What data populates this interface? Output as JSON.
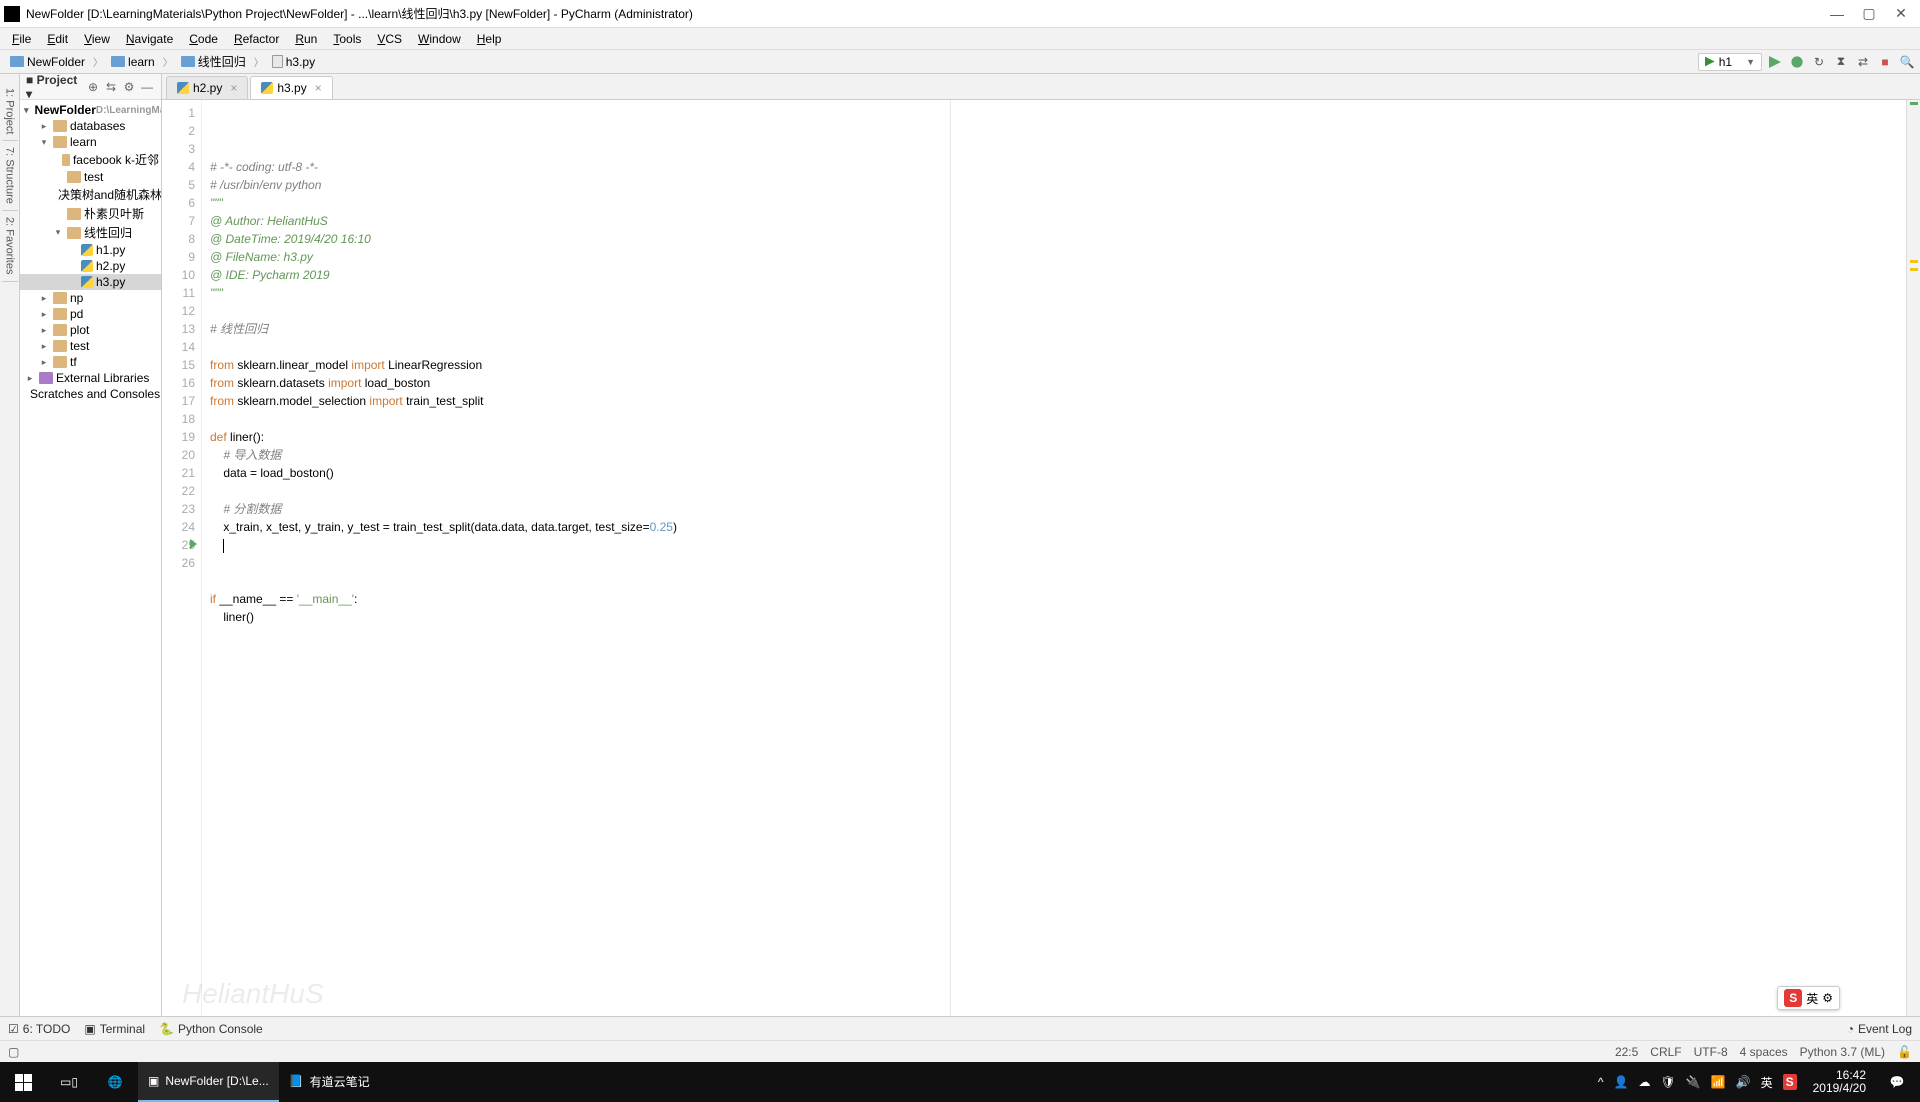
{
  "window": {
    "title": "NewFolder [D:\\LearningMaterials\\Python Project\\NewFolder] - ...\\learn\\线性回归\\h3.py [NewFolder] - PyCharm (Administrator)"
  },
  "menu": [
    "File",
    "Edit",
    "View",
    "Navigate",
    "Code",
    "Refactor",
    "Run",
    "Tools",
    "VCS",
    "Window",
    "Help"
  ],
  "breadcrumb": [
    {
      "type": "folder",
      "label": "NewFolder"
    },
    {
      "type": "folder",
      "label": "learn"
    },
    {
      "type": "folder",
      "label": "线性回归"
    },
    {
      "type": "file",
      "label": "h3.py"
    }
  ],
  "run_config": {
    "label": "h1"
  },
  "project_panel": {
    "title": "Project",
    "tree": {
      "root_label": "NewFolder",
      "root_hint": "D:\\LearningMa",
      "nodes": [
        {
          "label": "databases",
          "depth": 1,
          "toggle": "▸",
          "icon": "folder"
        },
        {
          "label": "learn",
          "depth": 1,
          "toggle": "▾",
          "icon": "folder"
        },
        {
          "label": "facebook k-近邻",
          "depth": 2,
          "toggle": "",
          "icon": "folder"
        },
        {
          "label": "test",
          "depth": 2,
          "toggle": "",
          "icon": "folder"
        },
        {
          "label": "决策树and随机森林",
          "depth": 2,
          "toggle": "",
          "icon": "folder"
        },
        {
          "label": "朴素贝叶斯",
          "depth": 2,
          "toggle": "",
          "icon": "folder"
        },
        {
          "label": "线性回归",
          "depth": 2,
          "toggle": "▾",
          "icon": "folder"
        },
        {
          "label": "h1.py",
          "depth": 3,
          "toggle": "",
          "icon": "pyfile"
        },
        {
          "label": "h2.py",
          "depth": 3,
          "toggle": "",
          "icon": "pyfile"
        },
        {
          "label": "h3.py",
          "depth": 3,
          "toggle": "",
          "icon": "pyfile",
          "selected": true
        },
        {
          "label": "np",
          "depth": 1,
          "toggle": "▸",
          "icon": "folder"
        },
        {
          "label": "pd",
          "depth": 1,
          "toggle": "▸",
          "icon": "folder"
        },
        {
          "label": "plot",
          "depth": 1,
          "toggle": "▸",
          "icon": "folder"
        },
        {
          "label": "test",
          "depth": 1,
          "toggle": "▸",
          "icon": "folder"
        },
        {
          "label": "tf",
          "depth": 1,
          "toggle": "▸",
          "icon": "folder"
        }
      ],
      "ext_lib": "External Libraries",
      "scratches": "Scratches and Consoles"
    }
  },
  "tabs": [
    {
      "label": "h2.py",
      "active": false
    },
    {
      "label": "h3.py",
      "active": true
    }
  ],
  "code_lines": [
    {
      "n": 1,
      "html": "<span class='c-comment'># -*- coding: utf-8 -*-</span>"
    },
    {
      "n": 2,
      "html": "<span class='c-comment'># /usr/bin/env python</span>"
    },
    {
      "n": 3,
      "html": "<span class='c-docstr'>\"\"\"</span>"
    },
    {
      "n": 4,
      "html": "<span class='c-docstr'>@ Author: HeliantHuS</span>"
    },
    {
      "n": 5,
      "html": "<span class='c-docstr'>@ DateTime: 2019/4/20 16:10</span>"
    },
    {
      "n": 6,
      "html": "<span class='c-docstr'>@ FileName: h3.py</span>"
    },
    {
      "n": 7,
      "html": "<span class='c-docstr'>@ IDE: Pycharm 2019</span>"
    },
    {
      "n": 8,
      "html": "<span class='c-docstr'>\"\"\"</span>"
    },
    {
      "n": 9,
      "html": ""
    },
    {
      "n": 10,
      "html": "<span class='c-comment'># 线性回归</span>"
    },
    {
      "n": 11,
      "html": ""
    },
    {
      "n": 12,
      "html": "<span class='c-kw'>from</span> sklearn.linear_model <span class='c-kw'>import</span> LinearRegression"
    },
    {
      "n": 13,
      "html": "<span class='c-kw'>from</span> sklearn.datasets <span class='c-kw'>import</span> load_boston"
    },
    {
      "n": 14,
      "html": "<span class='c-kw'>from</span> sklearn.model_selection <span class='c-kw'>import</span> train_test_split"
    },
    {
      "n": 15,
      "html": ""
    },
    {
      "n": 16,
      "html": "<span class='c-kw'>def</span> <span class='c-fn2'>liner</span>():"
    },
    {
      "n": 17,
      "html": "    <span class='c-comment'># 导入数据</span>"
    },
    {
      "n": 18,
      "html": "    data = load_boston()"
    },
    {
      "n": 19,
      "html": ""
    },
    {
      "n": 20,
      "html": "    <span class='c-comment'># 分割数据</span>"
    },
    {
      "n": 21,
      "html": "    x_train, x_test, y_train, y_test = train_test_split(data.data, data.target, <span>test_size=</span><span class='c-num'>0.25</span>)"
    },
    {
      "n": 22,
      "html": "    <span class='caret'></span>"
    },
    {
      "n": 23,
      "html": ""
    },
    {
      "n": 24,
      "html": ""
    },
    {
      "n": 25,
      "html": "<span class='c-kw'>if</span> __name__ == <span class='c-str'>'__main__'</span>:",
      "run": true
    },
    {
      "n": 26,
      "html": "    liner()"
    }
  ],
  "bottom_tools": {
    "todo": "6: TODO",
    "terminal": "Terminal",
    "python_console": "Python Console",
    "event_log": "Event Log"
  },
  "status": {
    "position": "22:5",
    "line_sep": "CRLF",
    "encoding": "UTF-8",
    "indent": "4 spaces",
    "interpreter": "Python 3.7 (ML)",
    "lock": "🔓"
  },
  "taskbar": {
    "apps": [
      {
        "label": "NewFolder [D:\\Le..."
      }
    ],
    "app2": "有道云笔记",
    "clock_time": "16:42",
    "clock_date": "2019/4/20"
  },
  "ime": {
    "label": "英"
  },
  "watermark": "HeliantHuS"
}
